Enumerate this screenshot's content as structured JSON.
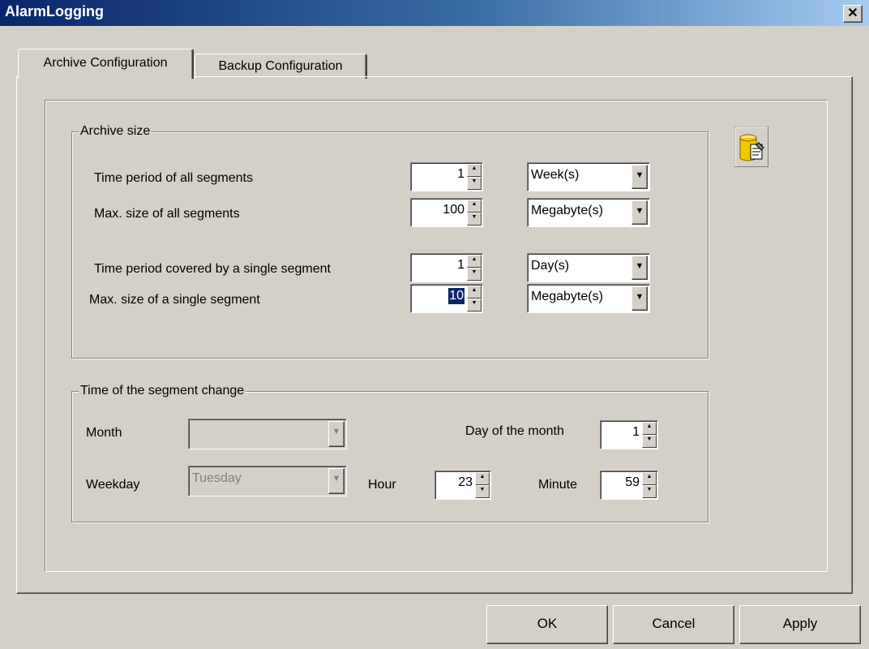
{
  "window": {
    "title": "AlarmLogging",
    "close_label": "✕"
  },
  "tabs": [
    {
      "label": "Archive Configuration",
      "active": true
    },
    {
      "label": "Backup Configuration",
      "active": false
    }
  ],
  "archive_size": {
    "legend": "Archive size",
    "rows": [
      {
        "label": "Time period of all segments",
        "value": "1",
        "unit": "Week(s)"
      },
      {
        "label": "Max. size of all segments",
        "value": "100",
        "unit": "Megabyte(s)"
      },
      {
        "label": "Time period covered by a single segment",
        "value": "1",
        "unit": "Day(s)"
      },
      {
        "label": "Max. size of a single segment",
        "value": "10",
        "unit": "Megabyte(s)"
      }
    ]
  },
  "segment_change": {
    "legend": "Time of the segment change",
    "month_label": "Month",
    "month_value": "",
    "weekday_label": "Weekday",
    "weekday_value": "Tuesday",
    "hour_label": "Hour",
    "hour_value": "23",
    "day_label": "Day of the month",
    "day_value": "1",
    "minute_label": "Minute",
    "minute_value": "59"
  },
  "buttons": {
    "ok": "OK",
    "cancel": "Cancel",
    "apply": "Apply"
  },
  "icons": {
    "archive": "database-archive-icon",
    "dropdown": "chevron-down-icon",
    "spin": "spin-arrows-icon"
  },
  "colors": {
    "face": "#d4d0c8",
    "title_start": "#0a246a",
    "title_end": "#a6caf0",
    "selection": "#0a246a"
  }
}
